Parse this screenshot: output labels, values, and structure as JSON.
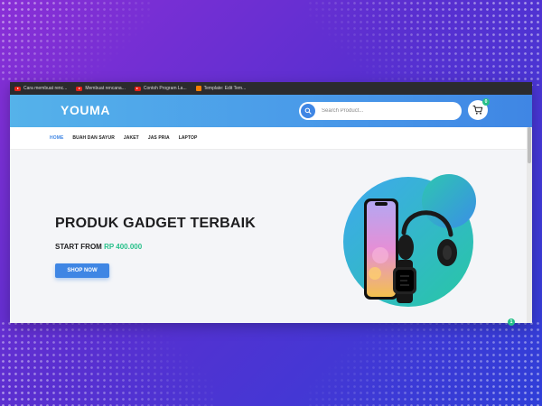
{
  "bookmarks": [
    {
      "label": "Cara membuat renc...",
      "icon": "youtube-icon"
    },
    {
      "label": "Membuat rencana...",
      "icon": "youtube-icon"
    },
    {
      "label": "Contoh Program La...",
      "icon": "youtube-icon"
    },
    {
      "label": "Template: Edit Tem...",
      "icon": "blogger-icon"
    }
  ],
  "header": {
    "logo": "YOUMA",
    "search_placeholder": "Search Product...",
    "cart_count": "0"
  },
  "nav": {
    "items": [
      "HOME",
      "BUAH DAN SAYUR",
      "JAKET",
      "JAS PRIA",
      "LAPTOP"
    ],
    "active": "HOME"
  },
  "hero": {
    "title": "PRODUK GADGET TERBAIK",
    "subtitle_prefix": "START FROM",
    "price": "RP 400.000",
    "button": "SHOP NOW"
  },
  "floating_badge": "1",
  "colors": {
    "primary": "#3f86e4",
    "accent": "#27c08a",
    "header_start": "#55b2ea"
  }
}
